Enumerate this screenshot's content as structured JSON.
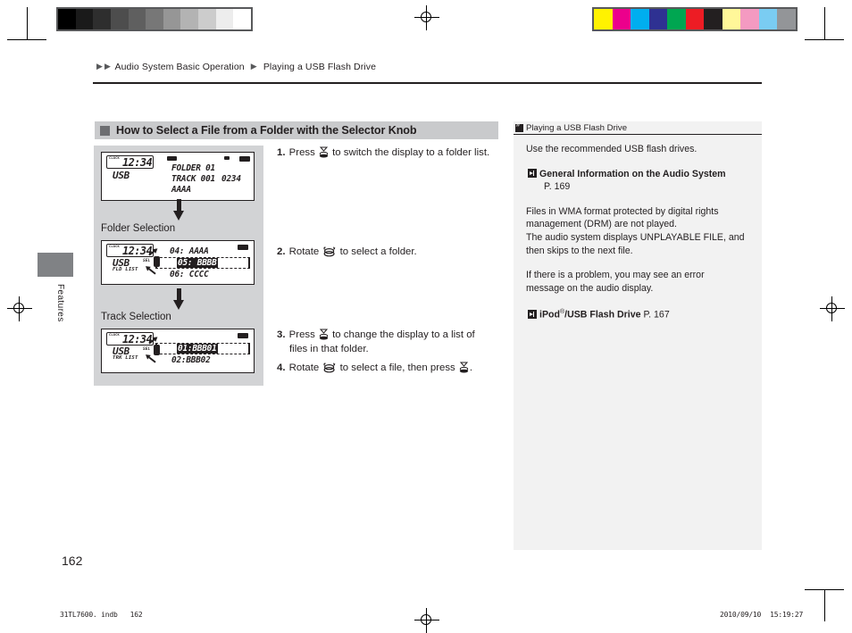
{
  "registration": {
    "gray_bar_name": "grayscale-calibration-bar",
    "gray_swatches": [
      "#000000",
      "#1a1a1a",
      "#2e2e2e",
      "#4d4d4d",
      "#5f5f5f",
      "#777777",
      "#969696",
      "#b3b3b3",
      "#cccccc",
      "#ededed",
      "#ffffff"
    ],
    "color_bar_name": "color-calibration-bar",
    "color_swatches": [
      "#fff200",
      "#ec008c",
      "#00aeef",
      "#2e3192",
      "#00a651",
      "#ed1c24",
      "#231f20",
      "#fff799",
      "#f49ac1",
      "#7accf2",
      "#939598"
    ]
  },
  "header": {
    "breadcrumb_first": "Audio System Basic Operation",
    "breadcrumb_second": "Playing a USB Flash Drive"
  },
  "side_tab": {
    "label": "Features"
  },
  "section": {
    "heading": "How to Select a File from a Folder with the Selector Knob"
  },
  "illustration": {
    "caption_folder": "Folder Selection",
    "caption_track": "Track Selection",
    "displays": [
      {
        "name": "now-playing-display",
        "clock_label": "CLOCK",
        "clock_time": "12:34",
        "source": "USB",
        "mode": "",
        "line1": "FOLDER 01",
        "line2": "TRACK 001",
        "line2_right": "0234",
        "line3": "AAAA"
      },
      {
        "name": "folder-list-display",
        "clock_label": "CLOCK",
        "clock_time": "12:34",
        "source": "USB",
        "mode": "FLD LIST",
        "item_above": "04: AAAA",
        "item_selected": "05: BBBB",
        "item_below": "06: CCCC",
        "knob_label": "SEL"
      },
      {
        "name": "track-list-display",
        "clock_label": "CLOCK",
        "clock_time": "12:34",
        "source": "USB",
        "mode": "TRK LIST",
        "item_above": "",
        "item_selected": "01:BBB01",
        "item_below": "02:BBB02",
        "knob_label": "SEL"
      }
    ]
  },
  "steps": [
    {
      "number": "1.",
      "text_before": "Press",
      "icon": "press-knob-icon",
      "text_after": "to switch the display to a folder list."
    },
    {
      "number": "2.",
      "text_before": "Rotate",
      "icon": "rotate-knob-icon",
      "text_after": "to select a folder."
    },
    {
      "number": "3.",
      "text_before": "Press",
      "icon": "press-knob-icon",
      "text_after": "to change the display to a list of files in that folder."
    },
    {
      "number": "4.",
      "text_before": "Rotate",
      "icon": "rotate-knob-icon",
      "text_mid": "to select a file, then press",
      "icon2": "press-knob-icon",
      "text_after": "."
    }
  ],
  "sidebar": {
    "title": "Playing a USB Flash Drive",
    "para1": "Use the recommended USB flash drives.",
    "ref1_bold": "General Information on the Audio System",
    "ref1_page": "P. 169",
    "para2_line1": "Files in WMA format protected by digital rights",
    "para2_line2": "management (DRM) are not played.",
    "para2_line3": "The audio system displays UNPLAYABLE FILE, and",
    "para2_line4": "then skips to the next file.",
    "para3_line1": "If there is a problem, you may see an error",
    "para3_line2": "message on the audio display.",
    "ref2_bold": "iPod",
    "ref2_sup": "®",
    "ref2_bold2": "/USB Flash Drive",
    "ref2_page": "P. 167"
  },
  "footer": {
    "page_number": "162",
    "file_name": "31TL7600. indb",
    "file_page": "162",
    "date": "2010/09/10",
    "time": "15:19:27"
  }
}
